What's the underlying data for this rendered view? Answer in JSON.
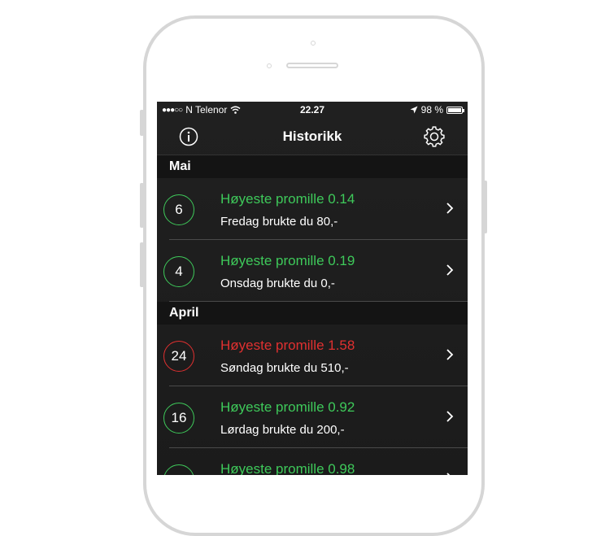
{
  "status": {
    "carrier": "N Telenor",
    "time": "22.27",
    "battery": "98 %",
    "battery_level": 0.98
  },
  "nav": {
    "title": "Historikk"
  },
  "colors": {
    "ok": "#3ec95a",
    "high": "#e03030"
  },
  "sections": [
    {
      "label": "Mai",
      "entries": [
        {
          "day": "6",
          "title": "Høyeste promille 0.14",
          "subtitle": "Fredag brukte du 80,-",
          "level": "ok"
        },
        {
          "day": "4",
          "title": "Høyeste promille 0.19",
          "subtitle": "Onsdag brukte du 0,-",
          "level": "ok"
        }
      ]
    },
    {
      "label": "April",
      "entries": [
        {
          "day": "24",
          "title": "Høyeste promille 1.58",
          "subtitle": "Søndag brukte du 510,-",
          "level": "high"
        },
        {
          "day": "16",
          "title": "Høyeste promille 0.92",
          "subtitle": "Lørdag brukte du 200,-",
          "level": "ok"
        },
        {
          "day": "",
          "title": "Høyeste promille 0.98",
          "subtitle": "",
          "level": "ok"
        }
      ]
    }
  ]
}
